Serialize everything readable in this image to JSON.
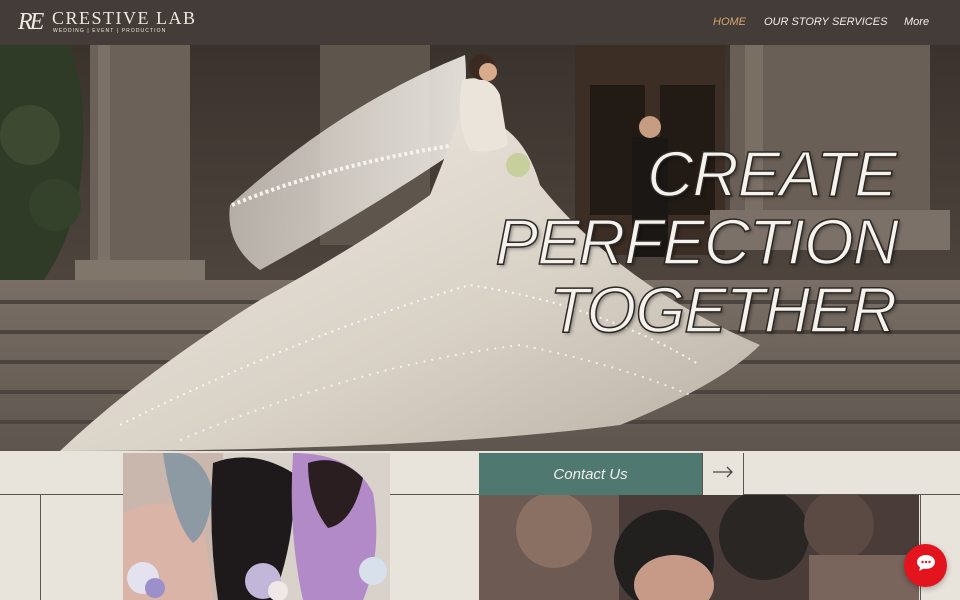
{
  "brand": {
    "monogram": "RE",
    "name": "CRESTIVE LAB",
    "tagline": "WEDDING | EVENT | PRODUCTION"
  },
  "nav": {
    "items": [
      {
        "label": "HOME",
        "active": true
      },
      {
        "label": "OUR STORY",
        "active": false
      },
      {
        "label": "SERVICES",
        "active": false
      },
      {
        "label": "More",
        "active": false
      }
    ]
  },
  "hero": {
    "lines": [
      "CREATE",
      "PERFECTION",
      "TOGETHER"
    ]
  },
  "cta": {
    "contact_label": "Contact Us",
    "arrow_icon": "arrow-right-icon"
  },
  "chat": {
    "icon": "chat-bubble-icon"
  },
  "colors": {
    "header_bg": "#433c38",
    "nav_active": "#d6a66c",
    "cta_bg": "#4f7870",
    "chat_bg": "#e3141d",
    "page_bg": "#e8e4dc"
  }
}
